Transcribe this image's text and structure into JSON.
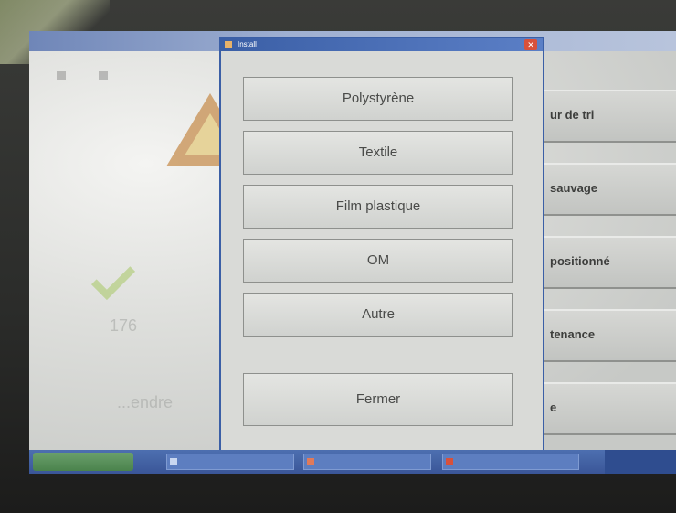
{
  "background_app": {
    "title": "",
    "right_buttons": [
      {
        "label": "ur de tri"
      },
      {
        "label": "sauvage"
      },
      {
        "label": "positionné"
      },
      {
        "label": "tenance"
      },
      {
        "label": "e"
      }
    ],
    "faded_number": "176",
    "faded_word": "...endre"
  },
  "modal": {
    "title": "Install",
    "close_label": "✕",
    "choices": [
      {
        "label": "Polystyrène"
      },
      {
        "label": "Textile"
      },
      {
        "label": "Film plastique"
      },
      {
        "label": "OM"
      },
      {
        "label": "Autre"
      }
    ],
    "close_button_label": "Fermer"
  },
  "colors": {
    "modal_border": "#3b5fa6",
    "taskbar": "#3a5698",
    "close_red": "#d8513b"
  }
}
